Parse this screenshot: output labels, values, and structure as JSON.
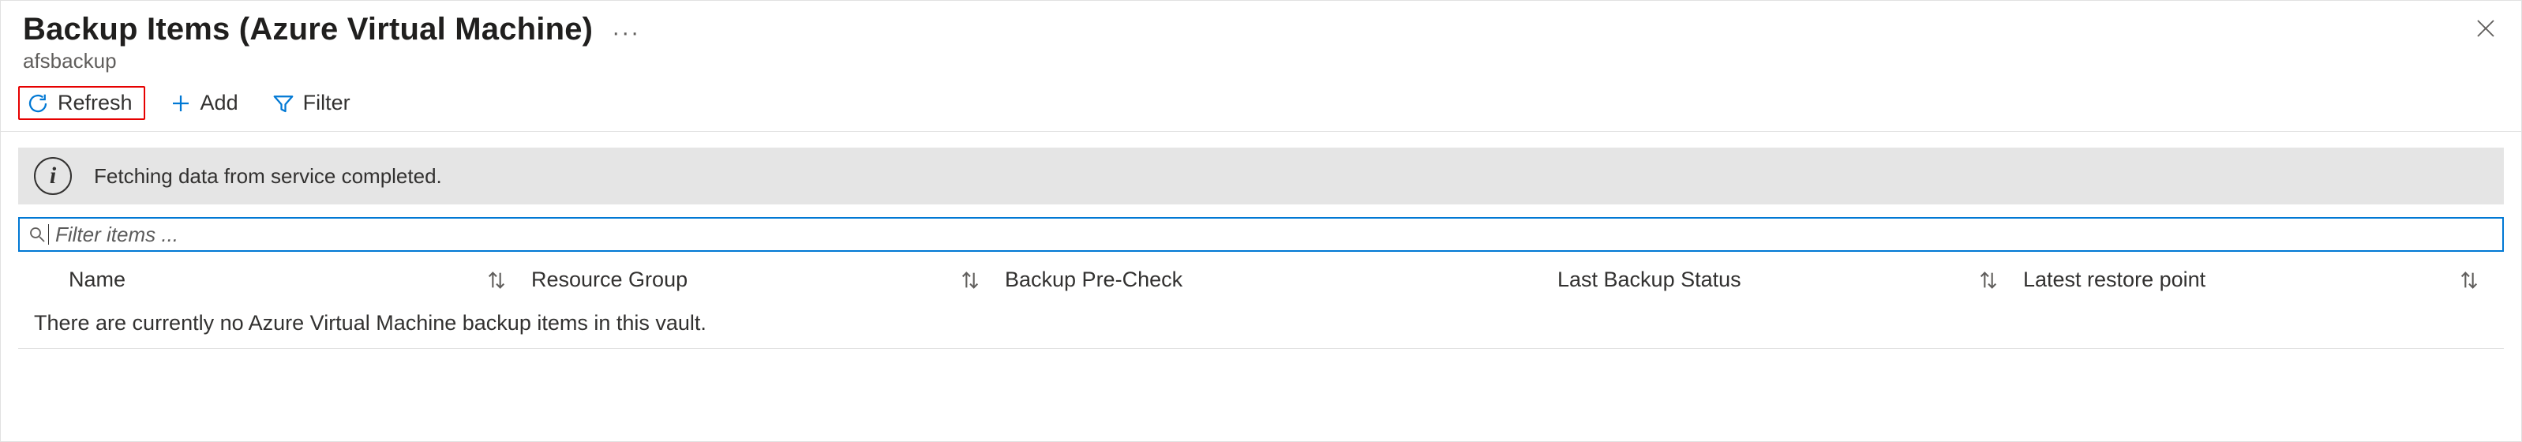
{
  "header": {
    "title": "Backup Items (Azure Virtual Machine)",
    "subtitle": "afsbackup"
  },
  "toolbar": {
    "refresh_label": "Refresh",
    "add_label": "Add",
    "filter_label": "Filter"
  },
  "banner": {
    "message": "Fetching data from service completed."
  },
  "filter": {
    "placeholder": "Filter items ...",
    "value": ""
  },
  "columns": {
    "c0": "Name",
    "c1": "Resource Group",
    "c2": "Backup Pre-Check",
    "c3": "Last Backup Status",
    "c4": "Latest restore point"
  },
  "empty_message": "There are currently no Azure Virtual Machine backup items in this vault."
}
